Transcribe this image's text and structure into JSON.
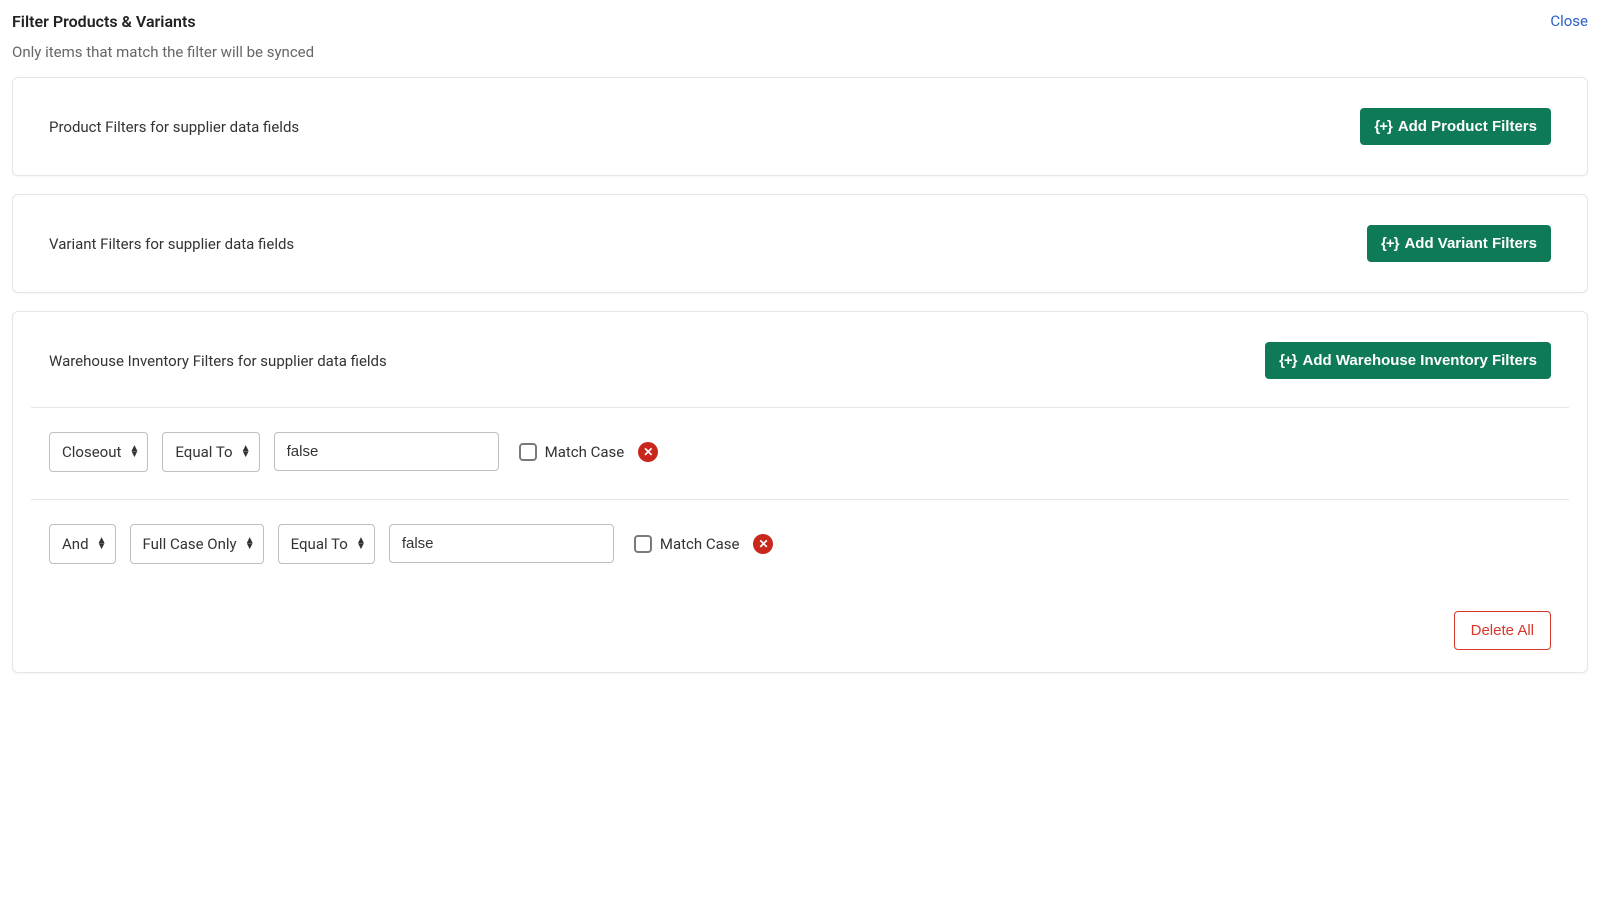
{
  "header": {
    "title": "Filter Products & Variants",
    "subtitle": "Only items that match the filter will be synced",
    "close": "Close"
  },
  "add_icon_text": "{+}",
  "sections": {
    "product": {
      "title": "Product Filters for supplier data fields",
      "add_label": "Add Product Filters"
    },
    "variant": {
      "title": "Variant Filters for supplier data fields",
      "add_label": "Add Variant Filters"
    },
    "warehouse": {
      "title": "Warehouse Inventory Filters for supplier data fields",
      "add_label": "Add Warehouse Inventory Filters",
      "rules": [
        {
          "logic": null,
          "field": "Closeout",
          "operator": "Equal To",
          "value": "false",
          "match_case": false,
          "match_case_label": "Match Case"
        },
        {
          "logic": "And",
          "field": "Full Case Only",
          "operator": "Equal To",
          "value": "false",
          "match_case": false,
          "match_case_label": "Match Case"
        }
      ],
      "delete_all": "Delete All"
    }
  }
}
